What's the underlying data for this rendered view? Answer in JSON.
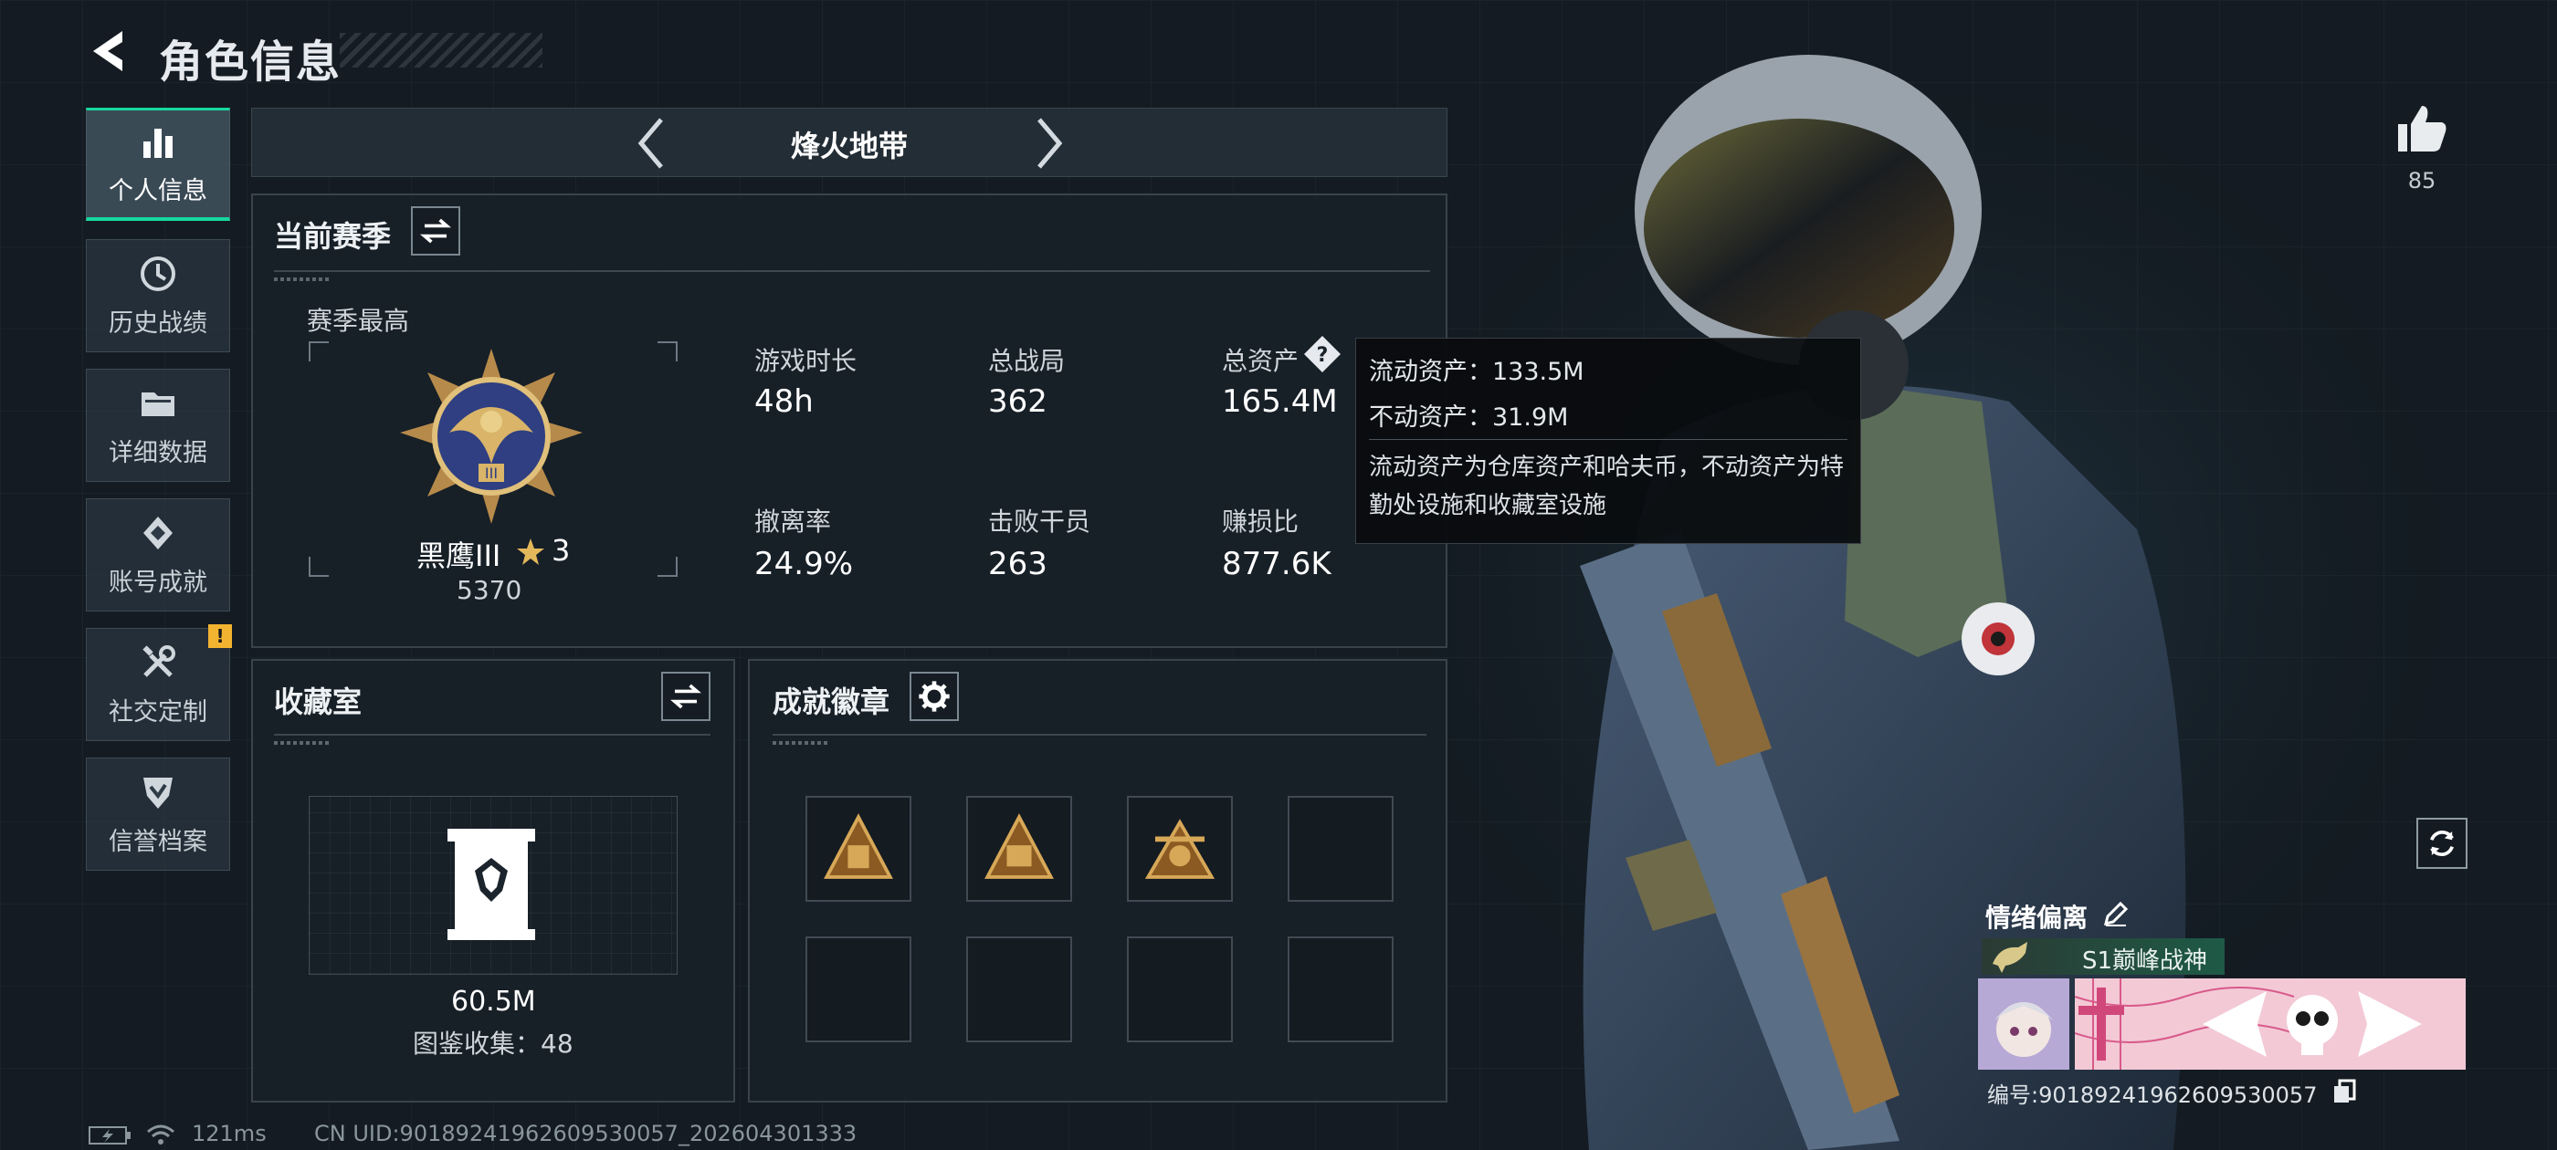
{
  "header": {
    "title": "角色信息"
  },
  "sidebar": {
    "items": [
      {
        "label": "个人信息",
        "icon": "bar-chart-icon",
        "active": true
      },
      {
        "label": "历史战绩",
        "icon": "history-clock-icon"
      },
      {
        "label": "详细数据",
        "icon": "folder-icon"
      },
      {
        "label": "账号成就",
        "icon": "achievement-diamond-icon"
      },
      {
        "label": "社交定制",
        "icon": "tools-icon",
        "badge": "!"
      },
      {
        "label": "信誉档案",
        "icon": "shield-check-icon"
      }
    ]
  },
  "season_nav": {
    "name": "烽火地带"
  },
  "current_season": {
    "title": "当前赛季",
    "rank": {
      "caption": "赛季最高",
      "name": "黑鹰III",
      "stars": "3",
      "points": "5370"
    },
    "stats": [
      {
        "label": "游戏时长",
        "value": "48h"
      },
      {
        "label": "总战局",
        "value": "362"
      },
      {
        "label": "总资产",
        "value": "165.4M"
      },
      {
        "label": "撤离率",
        "value": "24.9%"
      },
      {
        "label": "击败干员",
        "value": "263"
      },
      {
        "label": "赚损比",
        "value": "877.6K"
      }
    ]
  },
  "tooltip": {
    "liquid": "流动资产：133.5M",
    "fixed": "不动资产：31.9M",
    "description": "流动资产为仓库资产和哈夫币，不动资产为特勤处设施和收藏室设施"
  },
  "collection": {
    "title": "收藏室",
    "value": "60.5M",
    "catalog": "图鉴收集：48"
  },
  "achievements": {
    "title": "成就徽章",
    "badges": [
      "filled",
      "filled",
      "filled",
      "empty",
      "empty",
      "empty",
      "empty",
      "empty"
    ]
  },
  "profile": {
    "likes": "85",
    "name": "情绪偏离",
    "title_tag": "S1巅峰战神",
    "id": "编号:9018924196260953005​7"
  },
  "status_bar": {
    "ping": "121ms",
    "uid": "CN UID:9018924196260953005​7_202604301333"
  },
  "colors": {
    "accent": "#16d9a0",
    "warning": "#f2b430",
    "background": "#141b22"
  }
}
